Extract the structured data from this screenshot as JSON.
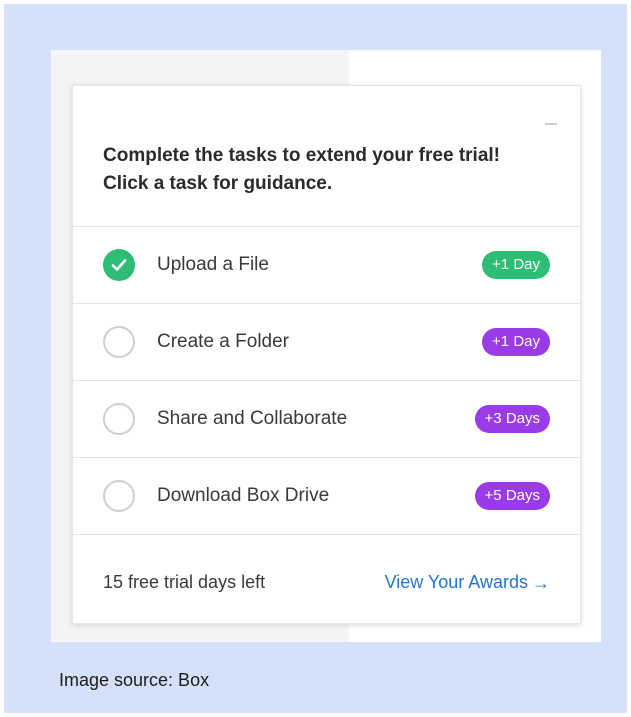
{
  "panel": {
    "heading_line1": "Complete the tasks to extend your free trial!",
    "heading_line2": "Click a task for guidance."
  },
  "tasks": [
    {
      "label": "Upload a File",
      "reward": "+1 Day",
      "completed": true,
      "badge_color": "#2ebd74"
    },
    {
      "label": "Create a Folder",
      "reward": "+1 Day",
      "completed": false,
      "badge_color": "#9a3be8"
    },
    {
      "label": "Share and Collaborate",
      "reward": "+3 Days",
      "completed": false,
      "badge_color": "#9a3be8"
    },
    {
      "label": "Download Box Drive",
      "reward": "+5 Days",
      "completed": false,
      "badge_color": "#9a3be8"
    }
  ],
  "footer": {
    "days_left": "15 free trial days left",
    "awards_link": "View Your Awards",
    "awards_arrow": "→"
  },
  "caption": "Image source: Box",
  "colors": {
    "frame_background": "#d5e0fb",
    "completed_green": "#2ebd74",
    "pending_purple": "#9a3be8",
    "link_blue": "#2474d4"
  },
  "icons": {
    "minimize": "minimize-icon",
    "completed": "checkmark-icon",
    "pending": "empty-circle-icon",
    "link_arrow": "arrow-right-icon"
  }
}
